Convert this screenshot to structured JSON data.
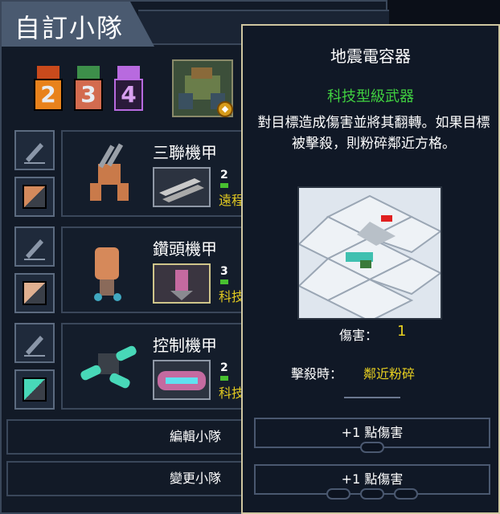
{
  "squad_panel": {
    "title": "自訂小隊",
    "medals": [
      {
        "number": "2",
        "color": "#e8821c",
        "ribbon": "#c94a1c"
      },
      {
        "number": "3",
        "color": "#d36b4f",
        "ribbon": "#3d8f4a"
      },
      {
        "number": "4",
        "color": "#b86adf",
        "ribbon": "#b86adf"
      }
    ],
    "mechs": [
      {
        "name": "三聯機甲",
        "weapon_level": "2",
        "weapon_type": "遠程",
        "color_swatch": [
          "#d48a5c",
          "#3a3f48"
        ],
        "icon": "artillery-mech-icon"
      },
      {
        "name": "鑽頭機甲",
        "weapon_level": "3",
        "weapon_type": "科技",
        "color_swatch": [
          "#e0b090",
          "#3a3f48"
        ],
        "icon": "drill-mech-icon"
      },
      {
        "name": "控制機甲",
        "weapon_level": "2",
        "weapon_type": "科技",
        "color_swatch": [
          "#48d8b8",
          "#3a3f48"
        ],
        "icon": "control-mech-icon"
      }
    ],
    "edit_squad": "編輯小隊",
    "change_squad": "變更小隊"
  },
  "tooltip": {
    "weapon_name": "地震電容器",
    "weapon_class": "科技型級武器",
    "description": "對目標造成傷害並將其翻轉。如果目標被擊殺，則粉碎鄰近方格。",
    "damage_label": "傷害：",
    "damage_value": "1",
    "on_kill_label": "擊殺時：",
    "on_kill_value": "鄰近粉碎",
    "upgrade_1": "+1  點傷害",
    "upgrade_2": "+1  點傷害"
  },
  "colors": {
    "accent_green": "#40d040",
    "accent_yellow": "#e8d020",
    "tooltip_border": "#cfc6a0"
  }
}
